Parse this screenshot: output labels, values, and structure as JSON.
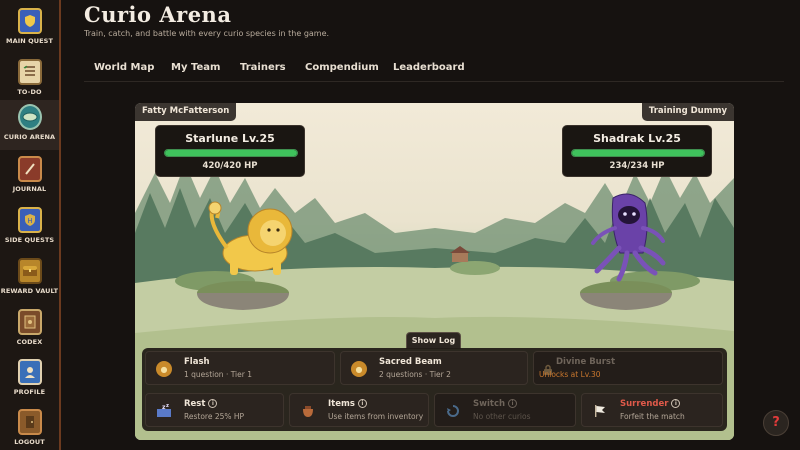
{
  "sidebar": {
    "items": [
      {
        "label": "MAIN QUEST",
        "icon": "shield-crest-icon",
        "color": "#3a5fb8"
      },
      {
        "label": "TO-DO",
        "icon": "checklist-icon",
        "color": "#c9a86a"
      },
      {
        "label": "CURIO ARENA",
        "icon": "arena-icon",
        "color": "#2f7f82"
      },
      {
        "label": "JOURNAL",
        "icon": "quill-book-icon",
        "color": "#8a3b2a"
      },
      {
        "label": "SIDE QUESTS",
        "icon": "side-quest-shield-icon",
        "color": "#3a5fb8"
      },
      {
        "label": "REWARD VAULT",
        "icon": "treasure-chest-icon",
        "color": "#b8862a"
      },
      {
        "label": "CODEX",
        "icon": "codex-book-icon",
        "color": "#7a4b2a"
      },
      {
        "label": "PROFILE",
        "icon": "profile-portrait-icon",
        "color": "#3a6fb8"
      },
      {
        "label": "LOGOUT",
        "icon": "door-exit-icon",
        "color": "#8a5a2a"
      }
    ]
  },
  "header": {
    "title": "Curio Arena",
    "subtitle": "Train, catch, and battle with every curio species in the game."
  },
  "nav": {
    "tabs": [
      "World Map",
      "My Team",
      "Trainers",
      "Compendium",
      "Leaderboard"
    ]
  },
  "battle": {
    "player_trainer": "Fatty McFatterson",
    "opponent_trainer": "Training Dummy",
    "player": {
      "name": "Starlune Lv.25",
      "hp_text": "420/420 HP",
      "hp_fraction": 1.0
    },
    "opponent": {
      "name": "Shadrak Lv.25",
      "hp_text": "234/234 HP",
      "hp_fraction": 1.0
    },
    "show_log_label": "Show Log",
    "actions": {
      "flash": {
        "title": "Flash",
        "sub": "1 question · Tier 1"
      },
      "sacred_beam": {
        "title": "Sacred Beam",
        "sub": "2 questions · Tier 2"
      },
      "divine_burst": {
        "title": "Divine Burst",
        "sub": "Unlocks at Lv.30"
      },
      "rest": {
        "title": "Rest",
        "sub": "Restore 25% HP"
      },
      "items": {
        "title": "Items",
        "sub": "Use items from inventory"
      },
      "switch": {
        "title": "Switch",
        "sub": "No other curios"
      },
      "surrender": {
        "title": "Surrender",
        "sub": "Forfeit the match"
      }
    }
  },
  "help": {
    "label": "?"
  },
  "colors": {
    "hp_green": "#3fc25c",
    "surrender_red": "#e05a4a",
    "locked_orange": "#c9772e",
    "accent_border": "#6b3a1f"
  }
}
